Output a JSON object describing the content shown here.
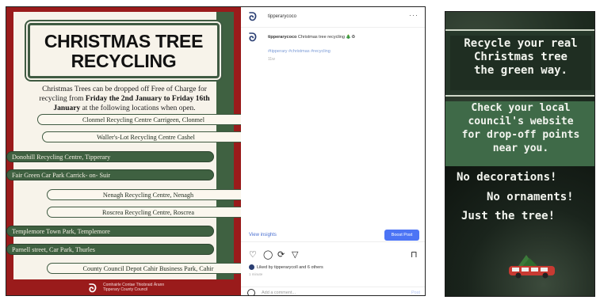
{
  "poster": {
    "title_line1": "CHRISTMAS TREE",
    "title_line2": "RECYCLING",
    "intro_before": "Christmas Trees can be dropped off Free of Charge for recycling from ",
    "intro_bold": "Friday the 2nd January to Friday 16th January",
    "intro_after": " at the following locations when open.",
    "locations": [
      "Clonmel Recycling Centre Carrigeen, Clonmel",
      "Waller's-Lot Recycling Centre Cashel",
      "Donohill Recycling Centre, Tipperary",
      "Fair Green Car Park Carrick- on- Suir",
      "Nenagh Recycling Centre, Nenagh",
      "Roscrea Recycling Centre, Roscrea",
      "Templemore Town Park, Templemore",
      "Parnell street, Car Park, Thurles",
      "County Council Depot Cahir Business Park, Cahir"
    ],
    "footer_line1": "Comhairle Contae Thiobraid Árann",
    "footer_line2": "Tipperary County Council"
  },
  "instagram": {
    "username": "tipperarycoco",
    "more": "···",
    "caption_user": "tipperarycoco",
    "caption_text": "Christmas tree recycling 🎄♻",
    "hashtags": "#tipperary #christmas #recycling",
    "time": "11w",
    "view_insights": "View insights",
    "boost_post": "Boost Post",
    "likes_text": "Liked by tipperarycoll and 6 others",
    "date_text": "1 minute",
    "comment_placeholder": "Add a comment...",
    "post_label": "Post"
  },
  "story": {
    "block1": [
      "Recycle your real",
      "Christmas tree",
      "the green way."
    ],
    "block2": [
      "Check your local",
      "council's website",
      "for drop-off points",
      "near you."
    ],
    "line_no_decorations": "No decorations!",
    "line_no_ornaments": "No ornaments!",
    "line_just_tree": "Just the tree!"
  },
  "colors": {
    "poster_red": "#9a1b1b",
    "poster_green": "#3f6141",
    "poster_cream": "#f7f3ea",
    "story_green": "#3f6a48",
    "boost_blue": "#4c74f5"
  },
  "icons": [
    "heart-icon",
    "comment-icon",
    "share-icon",
    "send-icon",
    "bookmark-icon",
    "emoji-icon",
    "council-logo-icon"
  ]
}
